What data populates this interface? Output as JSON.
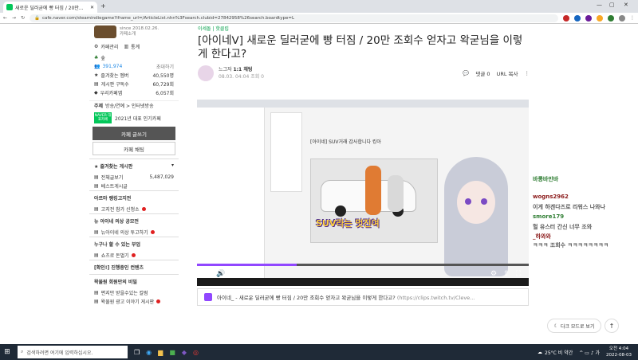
{
  "browser": {
    "tab_title": "새로운 딜러굳에 빵 터짐 / 20만...",
    "url": "cafe.naver.com/steamindiegame?iframe_url=/ArticleList.nhn%3Fsearch.clubid=27842958%26search.boardtype=L"
  },
  "sidebar": {
    "since": "since 2018.02.26.",
    "cafe_intro": "카페소개",
    "cafe_manage": "카페관리",
    "stats": "통계",
    "rank": "숲",
    "members": "391,974",
    "invite": "초대하기",
    "favorites_label": "즐겨찾는 멤버",
    "favorites_count": "40,550명",
    "subscribers_label": "게시판 구독수",
    "subscribers_count": "60,729회",
    "apps_label": "우리카페앱",
    "apps_count": "6,057회",
    "theme": "주제",
    "theme_value": "방송/연예 > 인터넷방송",
    "naver_badge": "NAVER 대표카페",
    "rep_cafe_year": "2021년 대표 인기카페",
    "write_btn": "카페 글쓰기",
    "chat_btn": "카페 채팅",
    "fav_boards": "즐겨찾는 게시판",
    "all_posts": "전체글보기",
    "all_posts_count": "5,487,029",
    "best_board": "베스트게시글",
    "section1": "아르마 랭킹고지전",
    "item1": "고지전 참가 신청소",
    "section2": "뉴 아이네 의상 공모전",
    "item2": "뉴아이네 의상 투고하기",
    "section3": "누구나 할 수 있는 부업",
    "item3": "쇼츠로 돈벌기",
    "section4": "[확인!] 진행중인 컨텐츠",
    "section5": "왁물원 회원만의 비밀",
    "item5a": "편지만 받을수있는 칼럼",
    "item5b": "왁물원 광고 이야기 게시판"
  },
  "article": {
    "board": "이세돌 | 핫클립",
    "title": "[아이네ᐯ] 새로운 딜러굳에 빵 터짐 / 20만 조회수 얻자고 왁굳님을 이렇게 한다고?",
    "author": "느그자",
    "author_level": "1:1 채팅",
    "date_line": "08.03. 04:04  조회 0",
    "comments": "댓글 0",
    "url_copy": "URL 복사"
  },
  "video": {
    "inner_title": "[아이네] SUV거래 감사합니다 킹아",
    "subtitle_text": "SUV라는 멋진여",
    "progress": 0.3
  },
  "clip_card": {
    "channel": "아이네_",
    "title": "- 새로운 딜러굳에 빵 터짐 / 20만 조회수 얻자고 왁굳님을 이렇게 한다고?",
    "link": "(https://clips.twitch.tv/Cleve..."
  },
  "chat": [
    {
      "user": "바롱바만바",
      "msg": "",
      "color": "#2e7d32"
    },
    {
      "user": "wogns2962",
      "msg": "",
      "color": "#8b1a1a"
    },
    {
      "user": "",
      "msg": "이게 하겐다즈로 리워스 나와나",
      "color": "#5a5a5a"
    },
    {
      "user": "smore179",
      "msg": "",
      "color": "#2e7d32"
    },
    {
      "user": "",
      "msg": "헐 유스터 간신 너무 조와",
      "color": "#5a5a5a"
    },
    {
      "user": "_하와와",
      "msg": "",
      "color": "#8b1a1a"
    },
    {
      "user": "",
      "msg": "ㅋㅋㅋ 조회수 ㅋㅋㅋㅋㅋㅋㅋㅋ",
      "color": "#5a5a5a"
    }
  ],
  "dark_mode": "다크 모드로 보기",
  "taskbar": {
    "search_placeholder": "검색하려면 여기에 입력하십시오.",
    "weather": "25°C 비 약간",
    "time": "오전 4:04",
    "date": "2022-08-03"
  },
  "colors": {
    "naver_green": "#03c75a",
    "taskbar": "#1f2a37",
    "twitch_purple": "#9147ff"
  }
}
